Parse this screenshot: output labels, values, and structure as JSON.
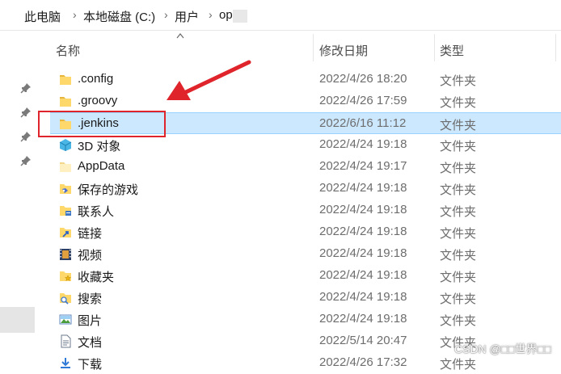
{
  "breadcrumb": {
    "items": [
      "此电脑",
      "本地磁盘 (C:)",
      "用户",
      "op"
    ]
  },
  "columns": {
    "name": "名称",
    "date": "修改日期",
    "type": "类型"
  },
  "files": [
    {
      "name": ".config",
      "date": "2022/4/26 18:20",
      "type": "文件夹",
      "icon": "folder-icon"
    },
    {
      "name": ".groovy",
      "date": "2022/4/26 17:59",
      "type": "文件夹",
      "icon": "folder-icon"
    },
    {
      "name": ".jenkins",
      "date": "2022/6/16 11:12",
      "type": "文件夹",
      "icon": "folder-icon",
      "selected": true
    },
    {
      "name": "3D 对象",
      "date": "2022/4/24 19:18",
      "type": "文件夹",
      "icon": "3d-objects-icon"
    },
    {
      "name": "AppData",
      "date": "2022/4/24 19:17",
      "type": "文件夹",
      "icon": "folder-icon"
    },
    {
      "name": "保存的游戏",
      "date": "2022/4/24 19:18",
      "type": "文件夹",
      "icon": "saved-games-icon"
    },
    {
      "name": "联系人",
      "date": "2022/4/24 19:18",
      "type": "文件夹",
      "icon": "contacts-icon"
    },
    {
      "name": "链接",
      "date": "2022/4/24 19:18",
      "type": "文件夹",
      "icon": "links-icon"
    },
    {
      "name": "视频",
      "date": "2022/4/24 19:18",
      "type": "文件夹",
      "icon": "videos-icon"
    },
    {
      "name": "收藏夹",
      "date": "2022/4/24 19:18",
      "type": "文件夹",
      "icon": "favorites-icon"
    },
    {
      "name": "搜索",
      "date": "2022/4/24 19:18",
      "type": "文件夹",
      "icon": "searches-icon"
    },
    {
      "name": "图片",
      "date": "2022/4/24 19:18",
      "type": "文件夹",
      "icon": "pictures-icon"
    },
    {
      "name": "文档",
      "date": "2022/5/14 20:47",
      "type": "文件夹",
      "icon": "documents-icon"
    },
    {
      "name": "下载",
      "date": "2022/4/26 17:32",
      "type": "文件夹",
      "icon": "downloads-icon"
    }
  ],
  "watermark": "CSDN @□□世界□□",
  "colors": {
    "selection": "#cce8ff",
    "annotation": "#e0242b",
    "folder": "#ffd86b"
  }
}
